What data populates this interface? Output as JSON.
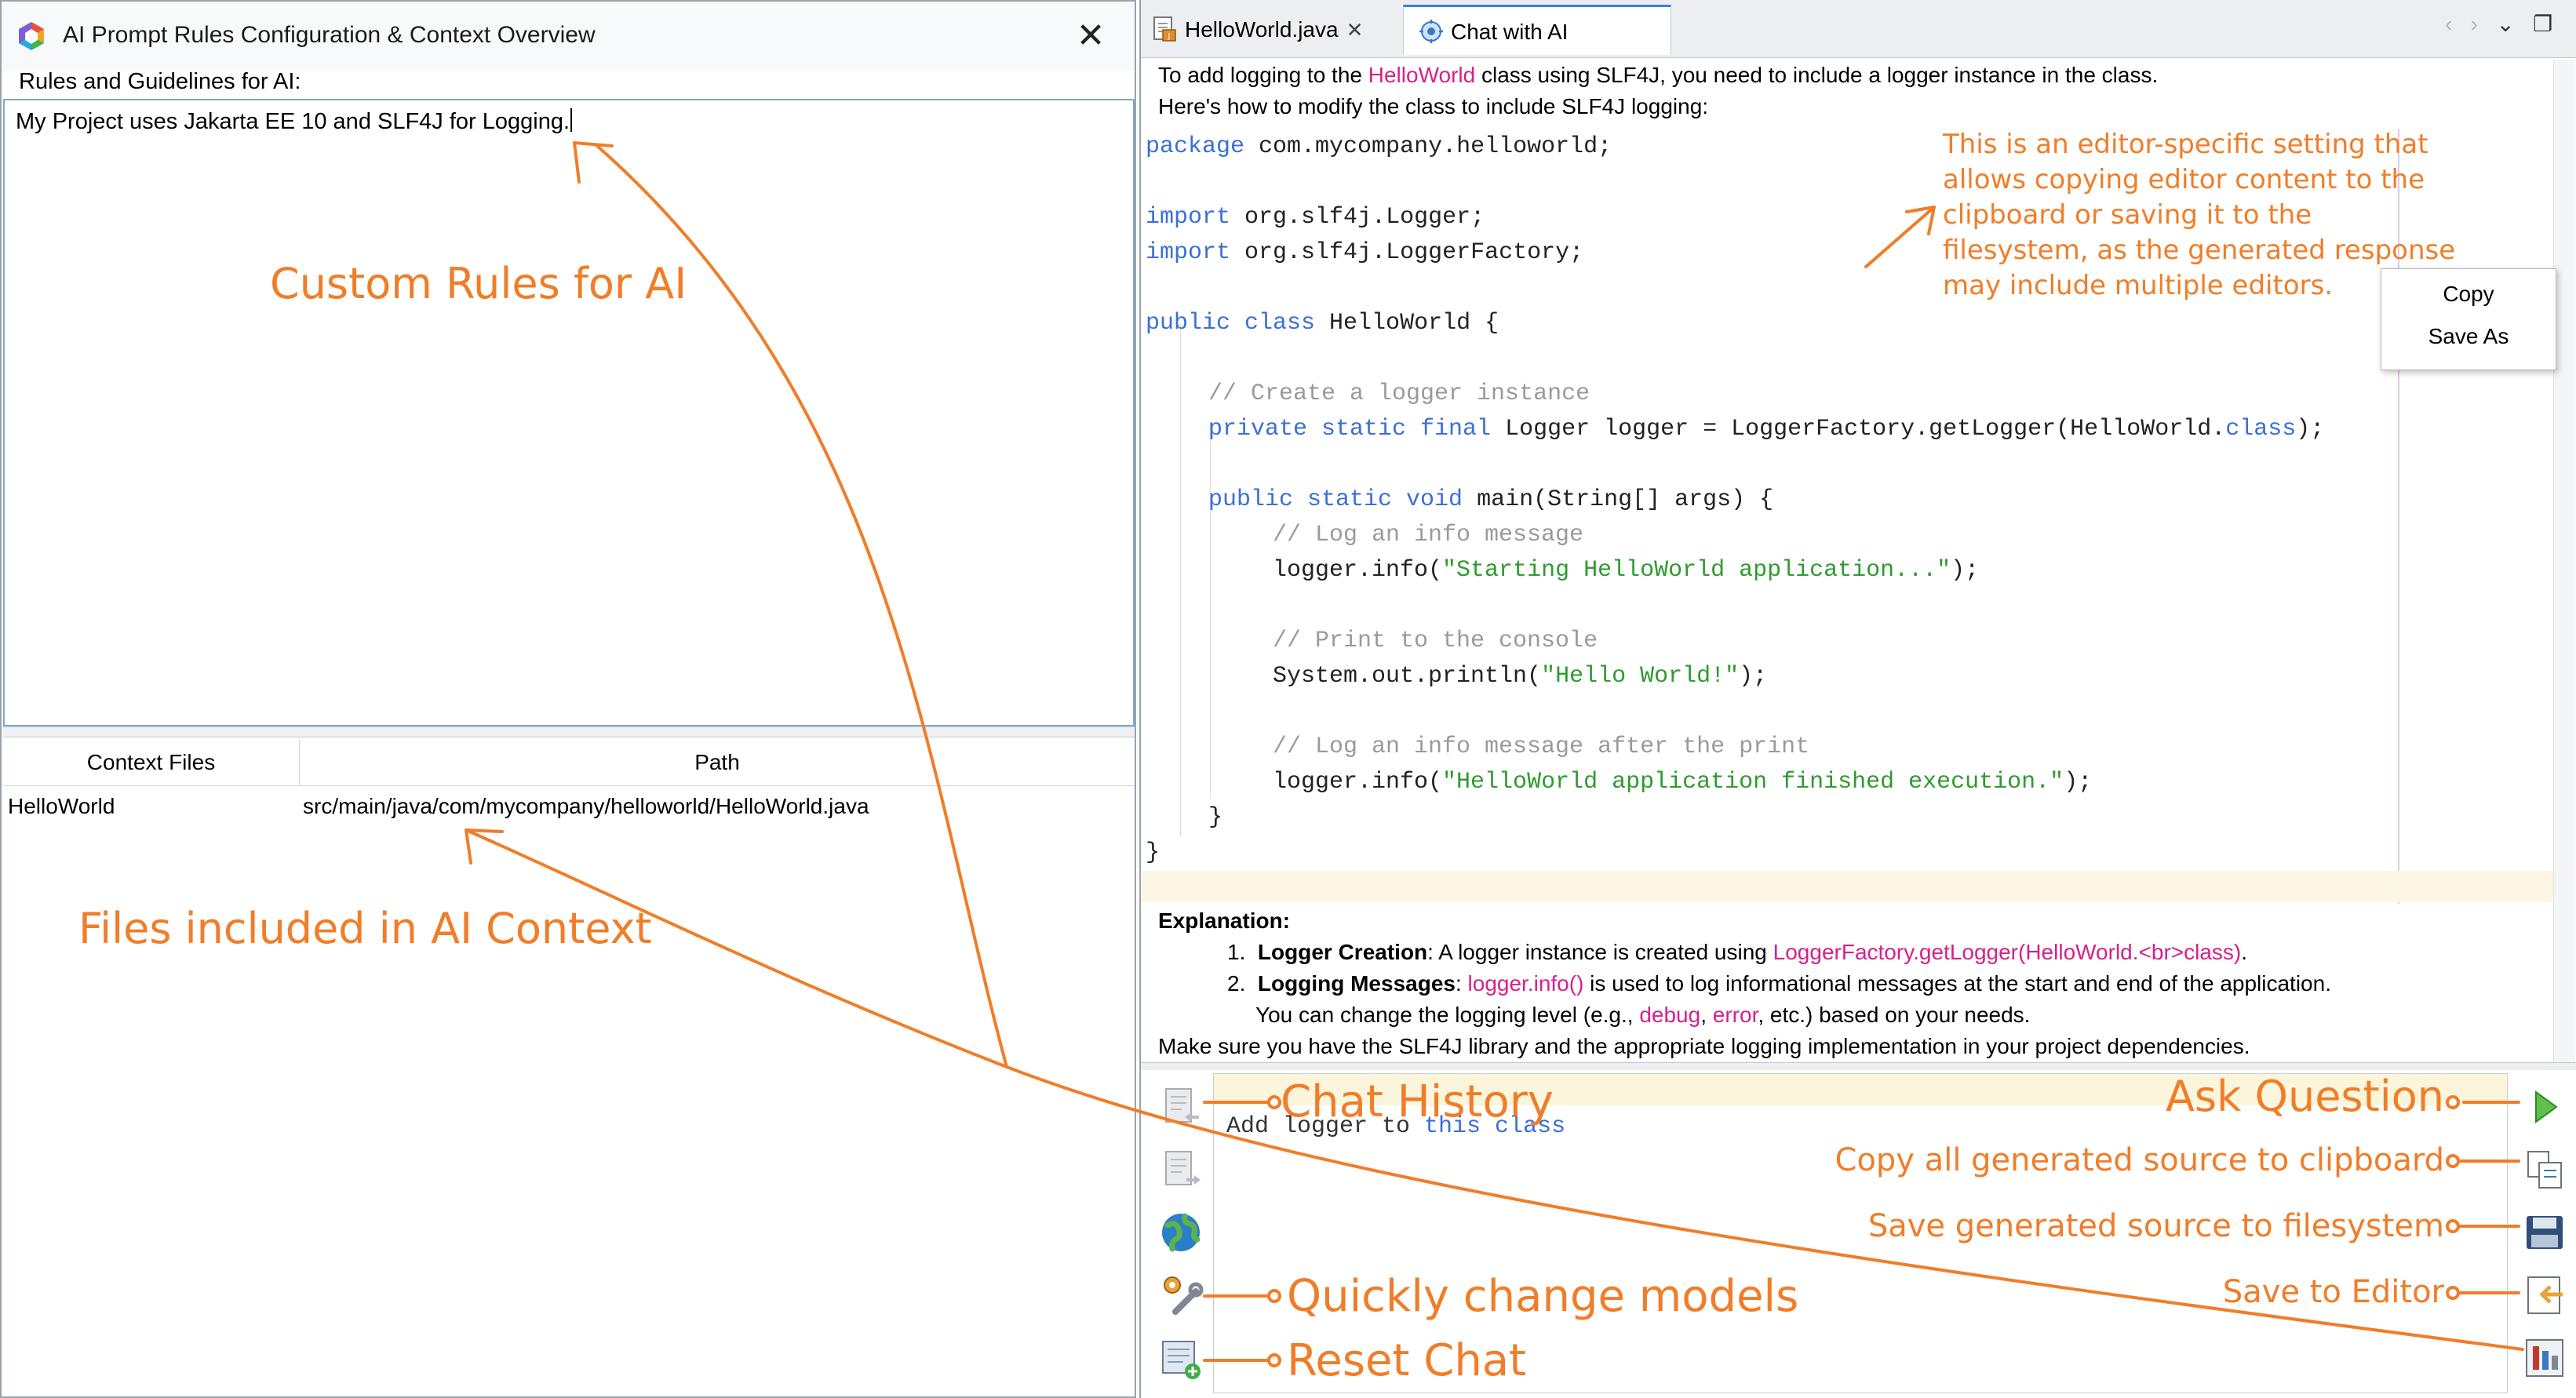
{
  "dialog": {
    "title": "AI Prompt Rules Configuration & Context Overview",
    "close_glyph": "✕",
    "rules_label": "Rules and Guidelines for AI:",
    "rules_text": "My Project uses Jakarta EE 10 and SLF4J for Logging.",
    "columns": [
      "Context Files",
      "Path"
    ],
    "rows": [
      {
        "file": "HelloWorld",
        "path": "src/main/java/com/mycompany/helloworld/HelloWorld.java"
      }
    ]
  },
  "editor": {
    "tabs": [
      {
        "label": "HelloWorld.java",
        "close": "✕",
        "icon": "java-file-icon"
      },
      {
        "label": "Chat with AI",
        "icon": "chat-ai-icon",
        "active": true
      }
    ],
    "nav": {
      "prev": "‹",
      "next": "›",
      "dropdown": "⌄",
      "restore": "❐"
    },
    "intro": {
      "pre": "To add logging to the ",
      "hl": "HelloWorld",
      "post": " class using SLF4J, you need to include a logger instance in the class.",
      "line2": "Here's how to modify the class to include SLF4J logging:"
    },
    "code": {
      "l1_kw": "package",
      "l1_rest": " com.mycompany.helloworld;",
      "l2_kw": "import",
      "l2_rest": " org.slf4j.Logger;",
      "l3_kw": "import",
      "l3_rest": " org.slf4j.LoggerFactory;",
      "l4_kw": "public class",
      "l4_rest": " HelloWorld {",
      "l5_cm": "// Create a logger instance",
      "l6_kw": "private static final",
      "l6_rest": " Logger logger = LoggerFactory.getLogger(HelloWorld.",
      "l6_kw2": "class",
      "l6_end": ");",
      "l7_kw": "public static void",
      "l7_rest": " main(String[] args) {",
      "l8_cm": "// Log an info message",
      "l9_a": "logger.info(",
      "l9_s": "\"Starting HelloWorld application...\"",
      "l9_e": ");",
      "l10_cm": "// Print to the console",
      "l11_a": "System.out.println(",
      "l11_s": "\"Hello World!\"",
      "l11_e": ");",
      "l12_cm": "// Log an info message after the print",
      "l13_a": "logger.info(",
      "l13_s": "\"HelloWorld application finished execution.\"",
      "l13_e": ");",
      "l14": "}",
      "l15": "}"
    },
    "context_menu": [
      "Copy",
      "Save As"
    ],
    "explanation": {
      "title": "Explanation:",
      "item1_num": "1.",
      "item1_bold": "Logger Creation",
      "item1_text": ": A logger instance is created using ",
      "item1_code": "LoggerFactory.getLogger(HelloWorld.<br>class)",
      "item1_end": ".",
      "item2_num": "2.",
      "item2_bold": "Logging Messages",
      "item2_text": ": ",
      "item2_code": "logger.info()",
      "item2_end": " is used to log informational messages at the start and end of the application.",
      "item2_line2_a": "You can change the logging level (e.g., ",
      "item2_line2_c1": "debug",
      "item2_line2_b": ", ",
      "item2_line2_c2": "error",
      "item2_line2_d": ", etc.) based on your needs.",
      "footer": "Make sure you have the SLF4J library and the appropriate logging implementation in your project dependencies."
    },
    "chat_input": {
      "a": "Add logger to ",
      "kw": "this class"
    }
  },
  "annotations": {
    "custom_rules": "Custom Rules for AI",
    "files_context": "Files included in AI Context",
    "editor_note": [
      "This is an editor-specific setting that",
      "allows copying editor content to the",
      "clipboard or saving it to the",
      "filesystem, as the generated response",
      "may include multiple editors."
    ],
    "chat_history": "Chat History",
    "quick_models": "Quickly change models",
    "reset_chat": "Reset Chat",
    "ask_question": "Ask Question",
    "copy_all": "Copy all generated source to clipboard",
    "save_fs": "Save generated source to filesystem",
    "save_editor": "Save to Editor"
  },
  "colors": {
    "annotation": "#f07d28",
    "keyword": "#3b6fd8",
    "string": "#2f9a2f",
    "comment": "#9a9a9a",
    "highlight": "#d6208a"
  }
}
